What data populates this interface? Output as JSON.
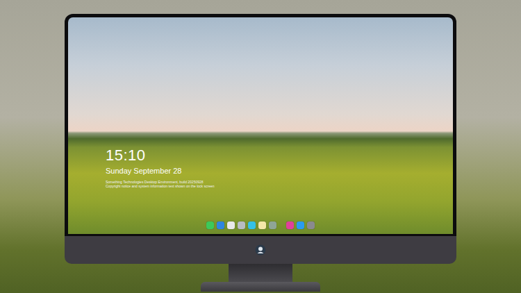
{
  "lock_screen": {
    "time": "15:10",
    "date": "Sunday September 28",
    "notes": [
      "Something Technologies Desktop Environment, build 20250928",
      "Copyright notice and system information text shown on the lock screen"
    ]
  },
  "dock": {
    "items": [
      {
        "kind": "app",
        "color": "#3cc95a"
      },
      {
        "kind": "app",
        "color": "#2f86e0"
      },
      {
        "kind": "app",
        "color": "#e9e9e9"
      },
      {
        "kind": "app",
        "color": "#b8bcc2"
      },
      {
        "kind": "app",
        "color": "#35c1e6"
      },
      {
        "kind": "app",
        "color": "#f5e7a8"
      },
      {
        "kind": "app",
        "color": "#8fa596"
      },
      {
        "kind": "separator",
        "color": "#00000000"
      },
      {
        "kind": "app",
        "color": "#e0409a"
      },
      {
        "kind": "app",
        "color": "#2a9cf0"
      },
      {
        "kind": "app",
        "color": "#8a8a8e"
      }
    ]
  }
}
